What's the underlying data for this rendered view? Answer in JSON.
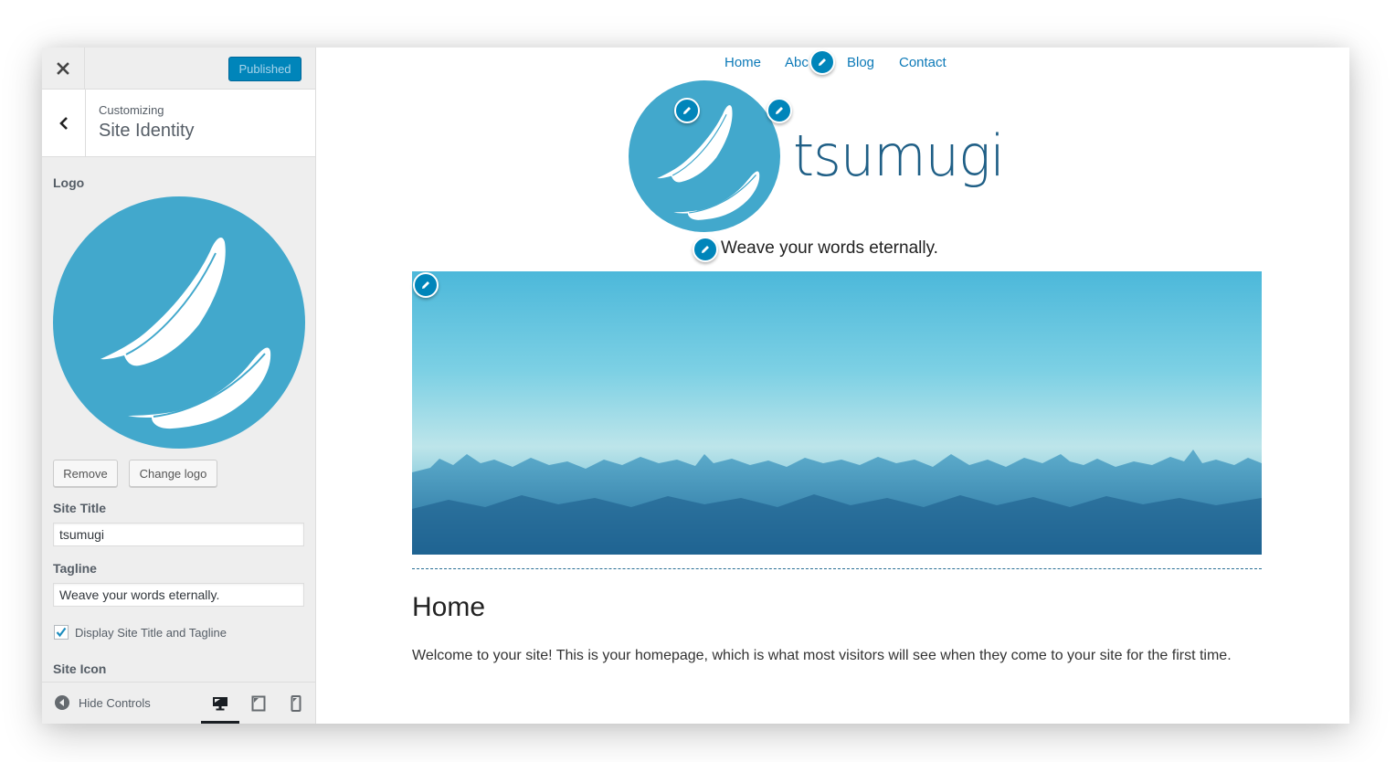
{
  "sidebar": {
    "close_icon": "close-icon",
    "publish_button": "Published",
    "customizing_label": "Customizing",
    "section_title": "Site Identity",
    "back_icon": "chevron-left-icon",
    "logo": {
      "label": "Logo",
      "remove_button": "Remove",
      "change_button": "Change logo"
    },
    "site_title": {
      "label": "Site Title",
      "value": "tsumugi"
    },
    "tagline": {
      "label": "Tagline",
      "value": "Weave your words eternally."
    },
    "display_checkbox": {
      "label": "Display Site Title and Tagline",
      "checked": true
    },
    "site_icon_label": "Site Icon",
    "footer": {
      "hide_controls": "Hide Controls",
      "devices": [
        "desktop",
        "tablet",
        "mobile"
      ],
      "active_device": "desktop"
    }
  },
  "preview": {
    "nav": [
      "Home",
      "About",
      "Blog",
      "Contact"
    ],
    "nav_visible": [
      "Home",
      "Abc",
      "Blog",
      "Contact"
    ],
    "site_title": "tsumugi",
    "tagline": "Weave your words eternally.",
    "page_heading": "Home",
    "page_body": "Welcome to your site! This is your homepage, which is what most visitors will see when they come to your site for the first time."
  },
  "colors": {
    "accent": "#0085ba",
    "logo_blue": "#42a8cc",
    "title_blue": "#1f5f86",
    "link_blue": "#0d7ab8"
  }
}
